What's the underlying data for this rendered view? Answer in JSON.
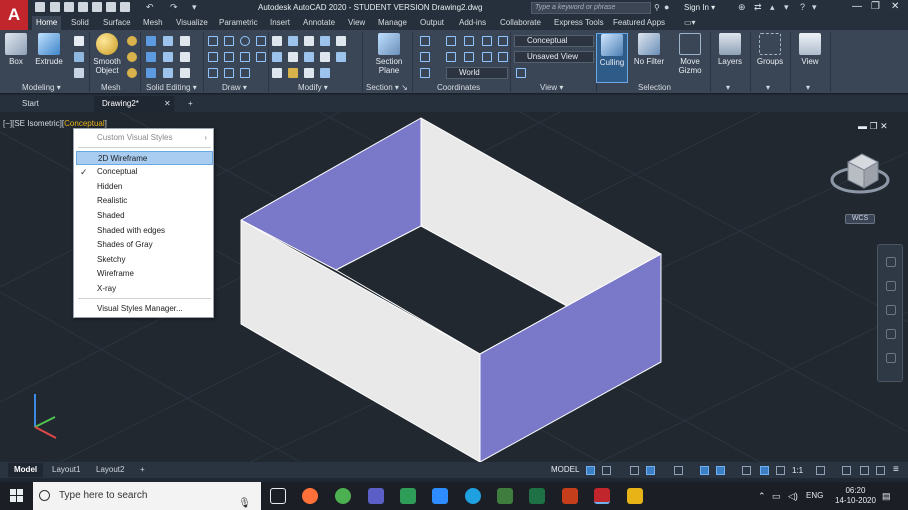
{
  "app": {
    "logo_letter": "A",
    "window_title": "Autodesk AutoCAD 2020 - STUDENT VERSION    Drawing2.dwg",
    "search_placeholder": "Type a keyword or phrase",
    "sign_in": "Sign In"
  },
  "ribbon_tabs": [
    "Home",
    "Solid",
    "Surface",
    "Mesh",
    "Visualize",
    "Parametric",
    "Insert",
    "Annotate",
    "View",
    "Manage",
    "Output",
    "Add-ins",
    "Collaborate",
    "Express Tools",
    "Featured Apps"
  ],
  "ribbon": {
    "buttons": {
      "box": "Box",
      "extrude": "Extrude",
      "smooth_object": "Smooth Object",
      "section_plane": "Section Plane",
      "culling": "Culling",
      "no_filter": "No Filter",
      "move_gizmo": "Move Gizmo",
      "layers": "Layers",
      "groups": "Groups",
      "view": "View"
    },
    "combos": {
      "visual_style": "Conceptual",
      "view_state": "Unsaved View",
      "coord": "World"
    },
    "panels": {
      "modeling": "Modeling",
      "mesh": "Mesh",
      "solid_editing": "Solid Editing",
      "draw": "Draw",
      "modify": "Modify",
      "section": "Section",
      "coordinates": "Coordinates",
      "view": "View",
      "selection": "Selection"
    }
  },
  "file_tabs": [
    "Start",
    "Drawing2*"
  ],
  "viewport": {
    "label_prefix": "[−][SE Isometric][",
    "label_style": "Conceptual",
    "label_suffix": "]",
    "wcs": "WCS"
  },
  "visual_styles_menu": {
    "header": "Custom Visual Styles",
    "items": [
      "2D Wireframe",
      "Conceptual",
      "Hidden",
      "Realistic",
      "Shaded",
      "Shaded with edges",
      "Shades of Gray",
      "Sketchy",
      "Wireframe",
      "X-ray"
    ],
    "hovered": "2D Wireframe",
    "checked": "Conceptual",
    "footer": "Visual Styles Manager..."
  },
  "layout_tabs": [
    "Model",
    "Layout1",
    "Layout2"
  ],
  "status_bar": {
    "model": "MODEL",
    "scale": "1:1"
  },
  "taskbar": {
    "search_placeholder": "Type here to search",
    "language": "ENG",
    "time": "06:20",
    "date": "14-10-2020"
  },
  "colors": {
    "accent_red": "#c0262b",
    "box_side": "#7a78c8",
    "box_light": "#e9e9ea",
    "highlight": "#e7b316"
  }
}
